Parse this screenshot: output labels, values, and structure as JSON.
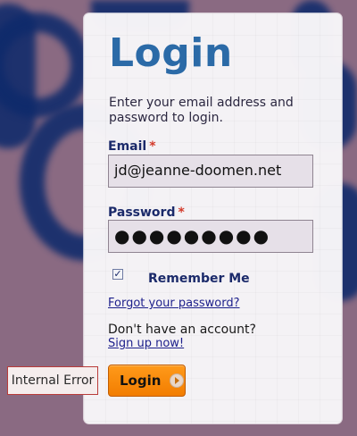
{
  "form": {
    "title": "Login",
    "intro": "Enter your email address and password to login.",
    "email": {
      "label": "Email",
      "required_mark": "*",
      "value": "jd@jeanne-doomen.net"
    },
    "password": {
      "label": "Password",
      "required_mark": "*",
      "masked_value": "●●●●●●●●●"
    },
    "remember_me": {
      "checked": true,
      "label": "Remember Me"
    },
    "forgot_password": "Forgot your password?",
    "no_account_text": "Don't have an account?",
    "signup_link": "Sign up now!",
    "login_button": "Login"
  },
  "error": {
    "text": "Internal Error"
  },
  "colors": {
    "background": "#8a6a82",
    "logo_blue": "#0e2a6b",
    "title_blue": "#2b6aa7",
    "label_navy": "#1b2a6a",
    "required_red": "#d33a2a",
    "button_orange": "#f58a0b",
    "error_border": "#b93c3a"
  },
  "icons": {
    "checkbox": "checkmark-icon",
    "login_button": "arrow-right-circle-icon"
  }
}
